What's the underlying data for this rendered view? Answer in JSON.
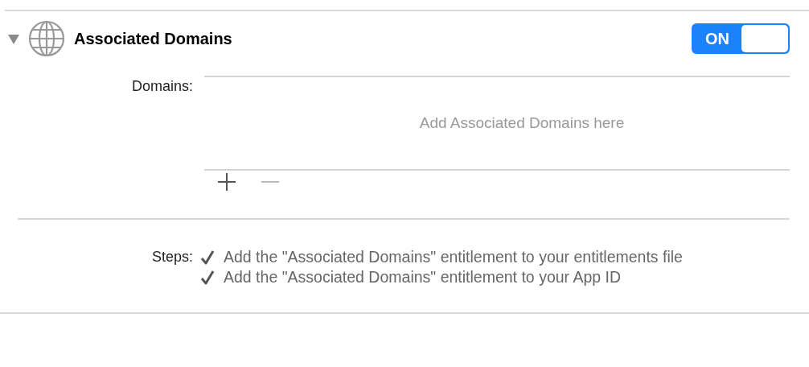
{
  "section": {
    "title": "Associated Domains",
    "expanded": true,
    "toggle": {
      "label": "ON",
      "on": true
    }
  },
  "domains": {
    "label": "Domains:",
    "placeholder": "Add Associated Domains here",
    "buttons": [
      {
        "kind": "add",
        "disabled": false
      },
      {
        "kind": "remove",
        "disabled": true
      }
    ]
  },
  "steps": {
    "label": "Steps:",
    "items": [
      {
        "text": "Add the \"Associated Domains\" entitlement to your entitlements file",
        "checked": true
      },
      {
        "text": "Add the \"Associated Domains\" entitlement to your App ID",
        "checked": true
      }
    ]
  }
}
